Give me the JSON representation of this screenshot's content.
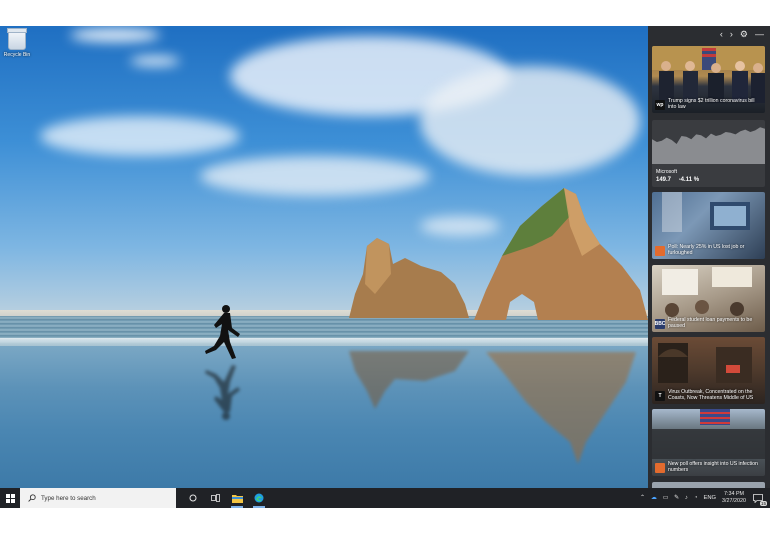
{
  "desktop": {
    "recycle_bin_label": "Recycle Bin"
  },
  "panel": {
    "header_icons": [
      "chevron-left-icon",
      "chevron-right-icon",
      "gear-icon",
      "minimize-icon"
    ],
    "cards": [
      {
        "source": "wp",
        "source_color": "#111111",
        "title": "Trump signs $2 trillion coronavirus bill into law"
      },
      {
        "type": "stock",
        "name": "Microsoft",
        "price": "149.7",
        "change": "-4.11 %"
      },
      {
        "source": "",
        "source_color": "#e36b2e",
        "title": "Poll: Nearly 25% in US lost job or furloughed"
      },
      {
        "source": "BBC",
        "source_color": "#2a3b6b",
        "title": "Federal student loan payments to be paused"
      },
      {
        "source": "T",
        "source_color": "#111111",
        "title": "Virus Outbreak, Concentrated on the Coasts, Now Threatens Middle of US"
      },
      {
        "source": "",
        "source_color": "#e36b2e",
        "title": "New poll offers insight into US infection numbers"
      }
    ]
  },
  "stock_chart": {
    "values": [
      0.62,
      0.55,
      0.58,
      0.66,
      0.6,
      0.5,
      0.7,
      0.68,
      0.62,
      0.74,
      0.72,
      0.64,
      0.76,
      0.7,
      0.73,
      0.8,
      0.78,
      0.74,
      0.82,
      0.86,
      0.8,
      0.84,
      0.92,
      0.88
    ]
  },
  "taskbar": {
    "search_placeholder": "Type here to search",
    "language": "ENG",
    "time": "7:34 PM",
    "date": "3/27/2020",
    "notification_count": "15"
  },
  "colors": {
    "panel_bg": "#2b2d31",
    "taskbar_bg": "#202226",
    "accent": "#7fb2e8"
  }
}
